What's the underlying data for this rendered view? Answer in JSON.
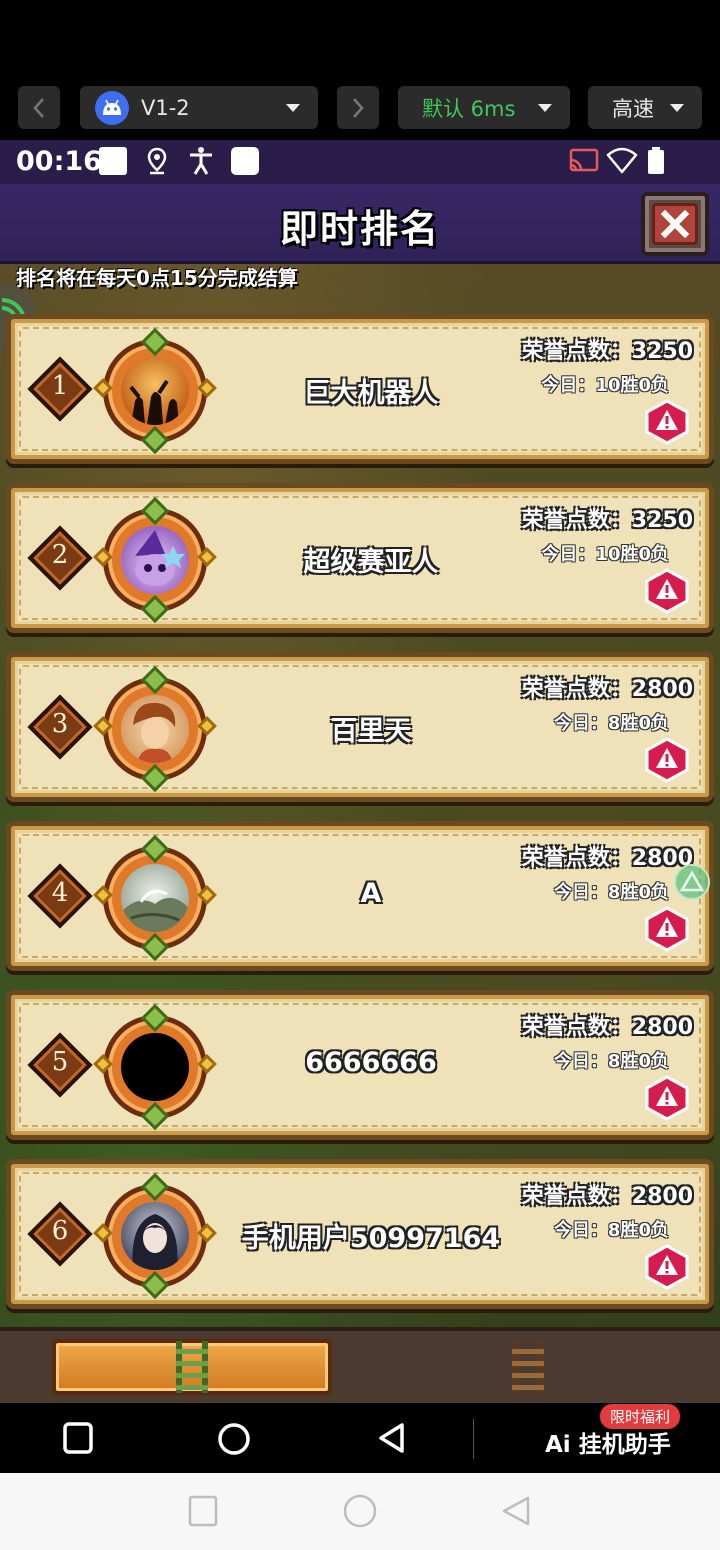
{
  "emulator": {
    "device_label": "V1-2",
    "latency_label": "默认 6ms",
    "speed_label": "高速"
  },
  "status_bar": {
    "time": "00:16"
  },
  "game": {
    "title": "即时排名",
    "notice": "排名将在每天0点15分完成结算",
    "rankings": [
      {
        "rank": "1",
        "name": "巨大机器人",
        "points": "荣誉点数：3250",
        "record": "今日：10胜0负"
      },
      {
        "rank": "2",
        "name": "超级赛亚人",
        "points": "荣誉点数：3250",
        "record": "今日：10胜0负"
      },
      {
        "rank": "3",
        "name": "百里天",
        "points": "荣誉点数：2800",
        "record": "今日：8胜0负"
      },
      {
        "rank": "4",
        "name": "A",
        "points": "荣誉点数：2800",
        "record": "今日：8胜0负"
      },
      {
        "rank": "5",
        "name": "6666666",
        "points": "荣誉点数：2800",
        "record": "今日：8胜0负"
      },
      {
        "rank": "6",
        "name": "手机用户50997164",
        "points": "荣誉点数：2800",
        "record": "今日：8胜0负"
      }
    ]
  },
  "assistant": {
    "label": "Ai 挂机助手",
    "promo_badge": "限时福利"
  },
  "colors": {
    "title_bar": "#3a2766",
    "card_bg": "#efe2b8",
    "latency_green": "#3ec85a",
    "report_red": "#d61c4e"
  }
}
